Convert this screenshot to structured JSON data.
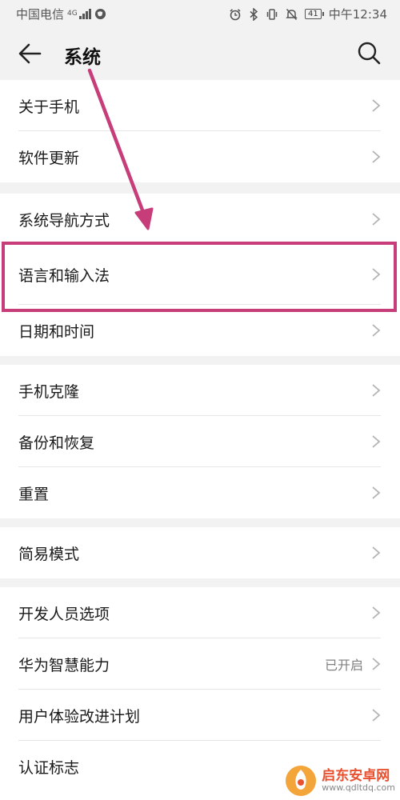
{
  "status_bar": {
    "carrier": "中国电信",
    "network": "4G",
    "battery": "41",
    "time": "中午12:34"
  },
  "header": {
    "title": "系统"
  },
  "groups": [
    {
      "items": [
        {
          "label": "关于手机"
        },
        {
          "label": "软件更新"
        }
      ]
    },
    {
      "items": [
        {
          "label": "系统导航方式"
        },
        {
          "label": "语言和输入法"
        },
        {
          "label": "日期和时间"
        }
      ]
    },
    {
      "items": [
        {
          "label": "手机克隆"
        },
        {
          "label": "备份和恢复"
        },
        {
          "label": "重置"
        }
      ]
    },
    {
      "items": [
        {
          "label": "简易模式"
        }
      ]
    },
    {
      "items": [
        {
          "label": "开发人员选项"
        },
        {
          "label": "华为智慧能力",
          "value": "已开启"
        },
        {
          "label": "用户体验改进计划"
        },
        {
          "label": "认证标志"
        }
      ]
    }
  ],
  "watermark": {
    "title": "启东安卓网",
    "url": "www.qdltdq.com"
  },
  "colors": {
    "annotation": "#c73d7a",
    "background": "#f2f2f2",
    "card": "#ffffff",
    "secondary_text": "#808080"
  }
}
